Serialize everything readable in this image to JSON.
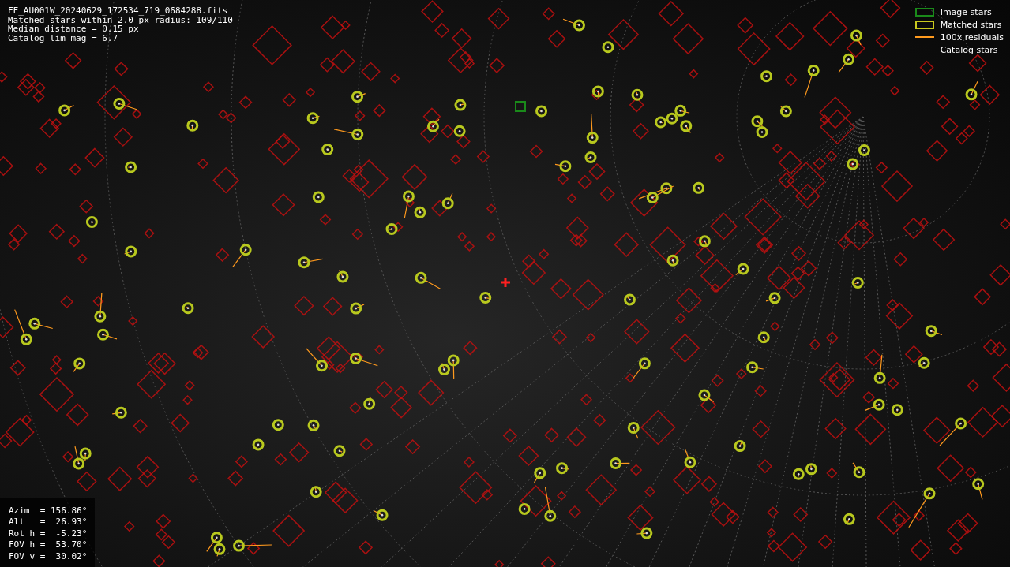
{
  "header": {
    "lines": [
      "FF_AU001W_20240629_172534_719_0684288.fits",
      "Matched stars within 2.0 px radius: 109/110",
      "Median distance = 0.15 px",
      "Catalog lim mag = 6.7"
    ]
  },
  "legend": [
    {
      "kind": "box",
      "label": "Image stars",
      "color": "#1a8a1a"
    },
    {
      "kind": "box",
      "label": "Matched stars",
      "color": "#c8c81e"
    },
    {
      "kind": "line",
      "label": "100x residuals",
      "color": "#ff9a1e"
    },
    {
      "kind": "none",
      "label": "Catalog stars"
    }
  ],
  "pointing": {
    "lines": [
      "Azim  = 156.86°",
      "Alt   =  26.93°",
      "Rot h =  -5.23°",
      "FOV h =  53.70°",
      "FOV v =  30.02°"
    ]
  }
}
